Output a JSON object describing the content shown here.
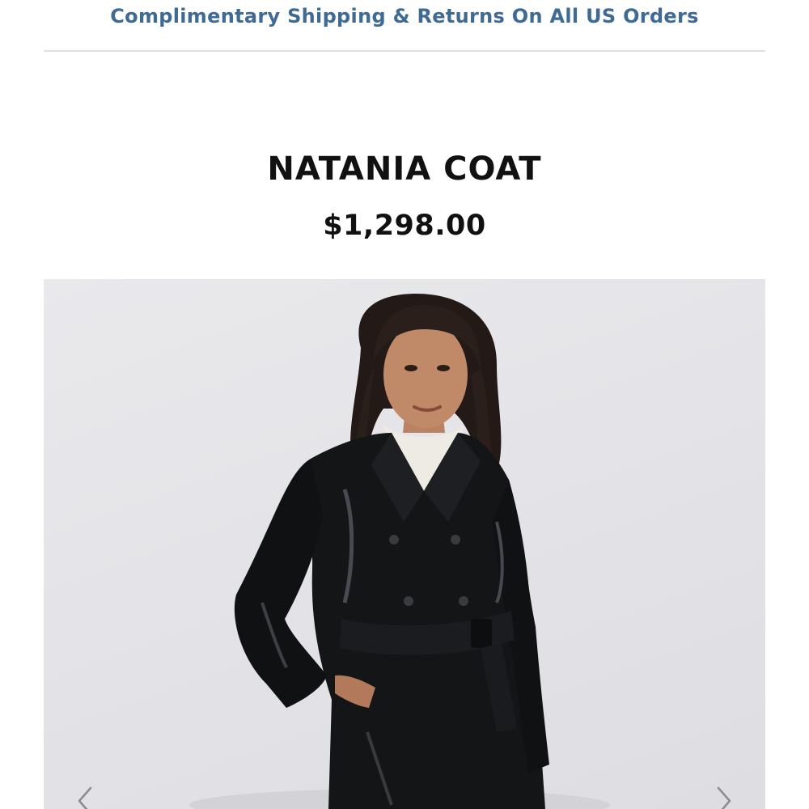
{
  "banner": {
    "promo_text": "Complimentary Shipping & Returns On All US Orders"
  },
  "product": {
    "name": "NATANIA COAT",
    "price": "$1,298.00"
  },
  "gallery": {
    "image_alt": "Model wearing black patent trench coat with belt over white turtleneck",
    "prev_icon": "chevron-left-icon",
    "next_icon": "chevron-right-icon"
  },
  "colors": {
    "banner_text": "#3e6a94",
    "title_text": "#111111",
    "divider": "#dcdfe3",
    "image_background": "#e6e6ea"
  }
}
